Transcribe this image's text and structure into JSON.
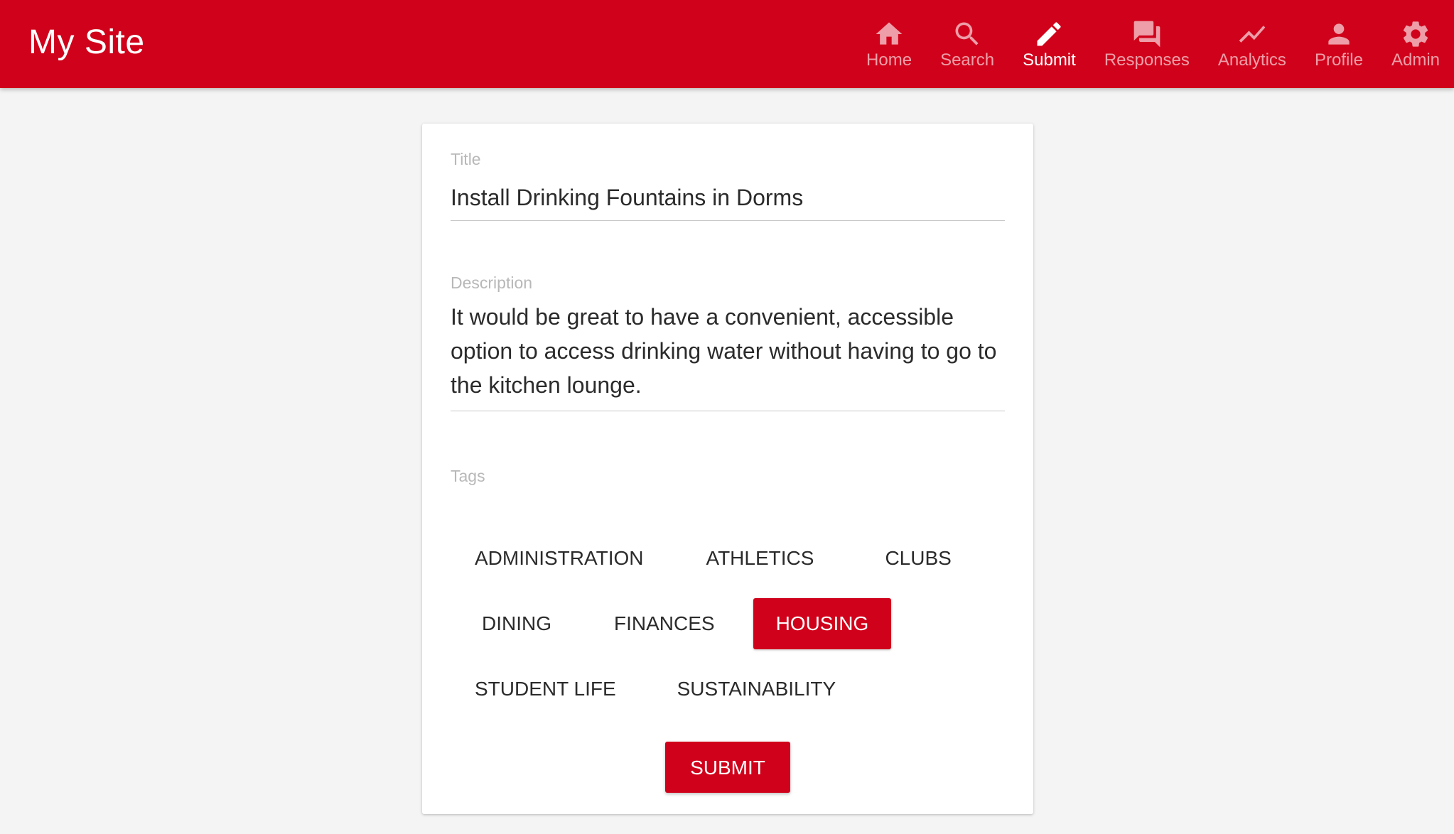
{
  "site": {
    "title": "My Site"
  },
  "colors": {
    "primary": "#d0021b",
    "background": "#f4f4f4",
    "card": "#ffffff"
  },
  "nav": {
    "items": [
      {
        "label": "Home",
        "icon": "home-icon",
        "active": false
      },
      {
        "label": "Search",
        "icon": "search-icon",
        "active": false
      },
      {
        "label": "Submit",
        "icon": "pencil-icon",
        "active": true
      },
      {
        "label": "Responses",
        "icon": "forum-icon",
        "active": false
      },
      {
        "label": "Analytics",
        "icon": "trending-line-icon",
        "active": false
      },
      {
        "label": "Profile",
        "icon": "person-icon",
        "active": false
      },
      {
        "label": "Admin",
        "icon": "gear-icon",
        "active": false
      }
    ]
  },
  "form": {
    "title_label": "Title",
    "title_value": "Install Drinking Fountains in Dorms",
    "description_label": "Description",
    "description_value": "It would be great to have a convenient, accessible option to access drinking water without having to go to the kitchen lounge.",
    "tags_label": "Tags",
    "tags": [
      {
        "label": "ADMINISTRATION",
        "selected": false
      },
      {
        "label": "ATHLETICS",
        "selected": false
      },
      {
        "label": "CLUBS",
        "selected": false
      },
      {
        "label": "DINING",
        "selected": false
      },
      {
        "label": "FINANCES",
        "selected": false
      },
      {
        "label": "HOUSING",
        "selected": true
      },
      {
        "label": "STUDENT LIFE",
        "selected": false
      },
      {
        "label": "SUSTAINABILITY",
        "selected": false
      }
    ],
    "submit_label": "SUBMIT"
  }
}
